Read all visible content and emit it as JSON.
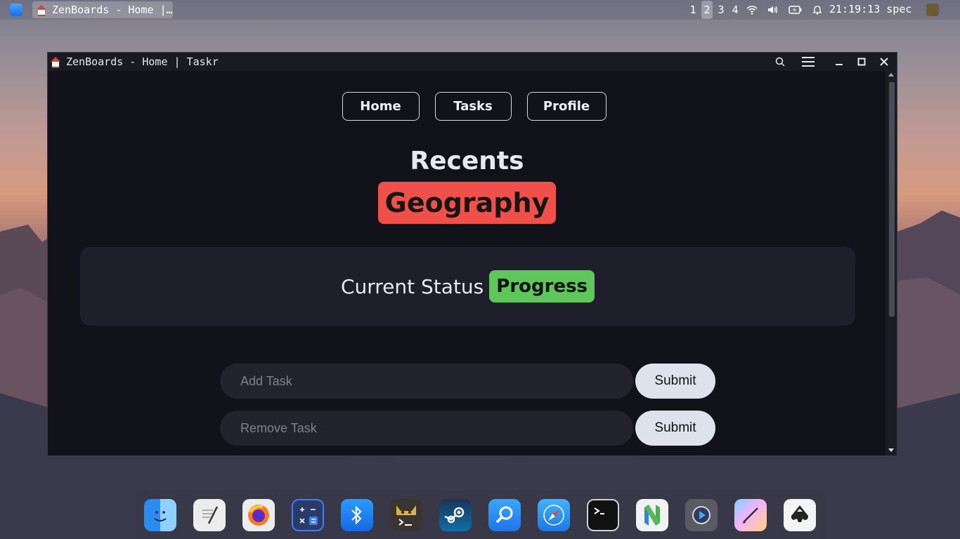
{
  "topbar": {
    "task_title": "ZenBoards - Home |…",
    "workspaces": [
      "1",
      "2",
      "3",
      "4"
    ],
    "active_workspace": "2",
    "clock": "21:19:13",
    "user": "spec",
    "icons": [
      "search-launcher-icon",
      "wifi-icon",
      "volume-icon",
      "battery-icon",
      "bell-icon"
    ]
  },
  "window": {
    "title": "ZenBoards - Home | Taskr",
    "controls": [
      "search-icon",
      "menu-icon",
      "minimize-icon",
      "maximize-icon",
      "close-icon"
    ]
  },
  "nav": {
    "home": "Home",
    "tasks": "Tasks",
    "profile": "Profile"
  },
  "recents": {
    "heading": "Recents",
    "board": "Geography",
    "board_color": "#f0504a"
  },
  "status": {
    "label": "Current Status",
    "value": "Progress",
    "value_color": "#5ec65a"
  },
  "forms": {
    "add_placeholder": "Add Task",
    "add_submit": "Submit",
    "remove_placeholder": "Remove Task",
    "remove_submit": "Submit"
  },
  "dock": {
    "apps": [
      "finder-icon",
      "text-editor-icon",
      "firefox-icon",
      "calculator-icon",
      "bluetooth-icon",
      "terminal-cat-icon",
      "steam-icon",
      "search-app-icon",
      "safari-icon",
      "terminal-icon",
      "neovim-icon",
      "media-player-icon",
      "drawing-app-icon",
      "inkscape-icon"
    ]
  }
}
